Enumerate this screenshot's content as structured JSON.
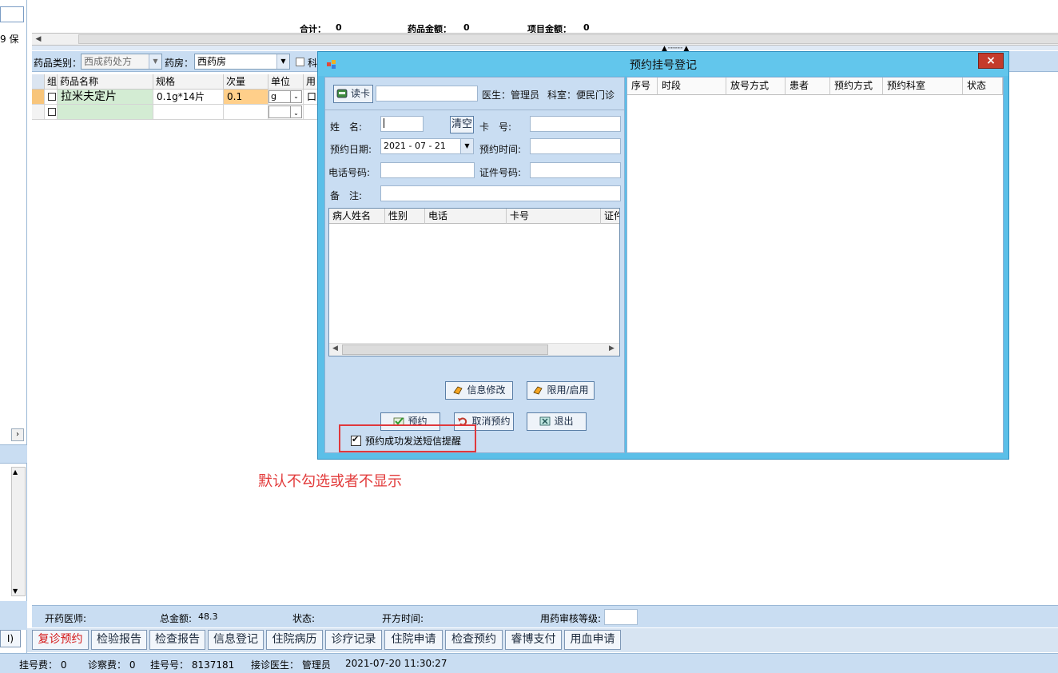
{
  "left_panel": {
    "text": "9 保"
  },
  "totals": {
    "total_label": "合计：",
    "total_value": "0",
    "drug_amount_label": "药品金额：",
    "drug_amount_value": "0",
    "item_amount_label": "项目金额：",
    "item_amount_value": "0"
  },
  "drug_bar": {
    "category_label": "药品类别：",
    "category_value": "西成药处方",
    "pharmacy_label": "药房：",
    "pharmacy_value": "西药房",
    "extra_label": "科"
  },
  "grid": {
    "headers": [
      "组",
      "药品名称",
      "规格",
      "次量",
      "单位",
      "用"
    ],
    "rows": [
      {
        "name": "拉米夫定片",
        "spec": "0.1g*14片",
        "dose": "0.1",
        "unit": "g",
        "use": "口"
      },
      {
        "name": "",
        "spec": "",
        "dose": "",
        "unit": "",
        "use": ""
      }
    ]
  },
  "dialog": {
    "title": "预约挂号登记",
    "close_label": "×",
    "read_card_label": "读卡",
    "doctor_label": "医生：",
    "doctor_value": "管理员",
    "dept_label": "科室：",
    "dept_value": "便民门诊",
    "name_label": "姓　名:",
    "clear_label": "清空",
    "card_no_label": "卡　号:",
    "appt_date_label": "预约日期:",
    "appt_date_value": "2021 - 07 - 21",
    "appt_time_label": "预约时间:",
    "phone_label": "电话号码:",
    "id_no_label": "证件号码:",
    "remark_label": "备　注:",
    "patient_table_headers": [
      "病人姓名",
      "性别",
      "电话",
      "卡号",
      "证件"
    ],
    "info_edit_label": "信息修改",
    "limit_enable_label": "限用/启用",
    "book_label": "预约",
    "cancel_book_label": "取消预约",
    "exit_label": "退出",
    "sms_label": "预约成功发送短信提醒",
    "right_table_headers": [
      "序号",
      "时段",
      "放号方式",
      "患者",
      "预约方式",
      "预约科室",
      "状态"
    ]
  },
  "annotation": "默认不勾选或者不显示",
  "bottom_info": {
    "doctor_label": "开药医师:",
    "total_label": "总金额:",
    "total_value": "48.3",
    "status_label": "状态:",
    "time_label": "开方时间:",
    "audit_label": "用药审核等级:"
  },
  "tabs": [
    "复诊预约",
    "检验报告",
    "检查报告",
    "信息登记",
    "住院病历",
    "诊疗记录",
    "住院申请",
    "检查预约",
    "睿博支付",
    "用血申请"
  ],
  "left_tab_stub": "I)",
  "status_bar": {
    "reg_fee": "挂号费： 0",
    "consult_fee": "诊察费： 0",
    "reg_no": "挂号号： 8137181",
    "doctor": "接诊医生： 管理员",
    "datetime": "2021-07-20 11:30:27"
  },
  "colors": {
    "accent": "#5bbfe8",
    "panel": "#c9ddf2",
    "annotation": "#e23a3a"
  }
}
